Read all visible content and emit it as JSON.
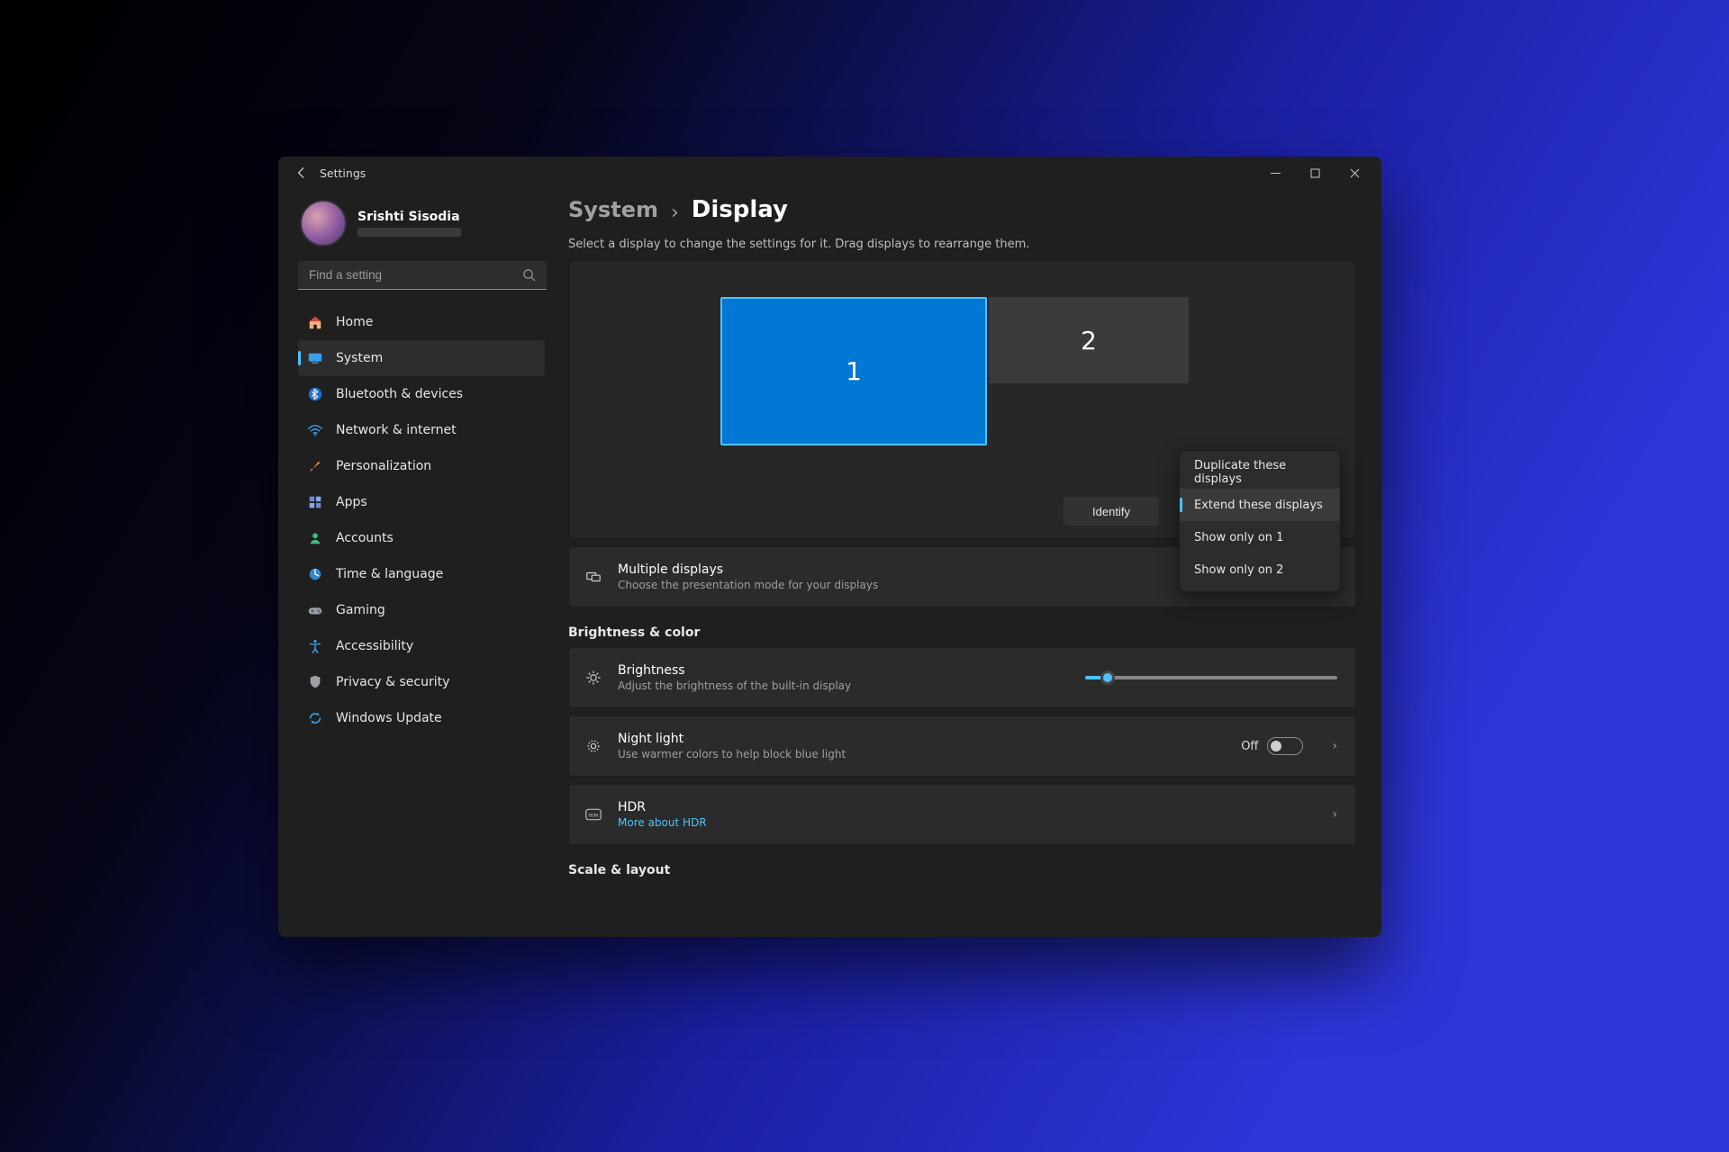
{
  "titlebar": {
    "title": "Settings"
  },
  "user": {
    "name": "Srishti Sisodia"
  },
  "search": {
    "placeholder": "Find a setting"
  },
  "sidebar": {
    "items": [
      {
        "label": "Home"
      },
      {
        "label": "System"
      },
      {
        "label": "Bluetooth & devices"
      },
      {
        "label": "Network & internet"
      },
      {
        "label": "Personalization"
      },
      {
        "label": "Apps"
      },
      {
        "label": "Accounts"
      },
      {
        "label": "Time & language"
      },
      {
        "label": "Gaming"
      },
      {
        "label": "Accessibility"
      },
      {
        "label": "Privacy & security"
      },
      {
        "label": "Windows Update"
      }
    ]
  },
  "breadcrumb": {
    "parent": "System",
    "current": "Display"
  },
  "hint": "Select a display to change the settings for it. Drag displays to rearrange them.",
  "displays": {
    "mon1": "1",
    "mon2": "2"
  },
  "identify_label": "Identify",
  "projection_menu": {
    "items": [
      "Duplicate these displays",
      "Extend these displays",
      "Show only on 1",
      "Show only on 2"
    ],
    "selected_index": 1
  },
  "multi": {
    "title": "Multiple displays",
    "sub": "Choose the presentation mode for your displays"
  },
  "section_brightness": "Brightness & color",
  "brightness": {
    "title": "Brightness",
    "sub": "Adjust the brightness of the built-in display",
    "value_pct": 9
  },
  "nightlight": {
    "title": "Night light",
    "sub": "Use warmer colors to help block blue light",
    "state": "Off"
  },
  "hdr": {
    "title": "HDR",
    "sub": "More about HDR"
  },
  "section_scale": "Scale & layout"
}
